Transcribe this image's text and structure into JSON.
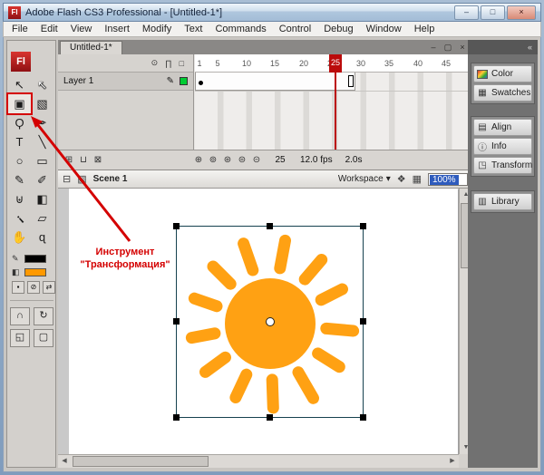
{
  "window": {
    "title": "Adobe Flash CS3 Professional - [Untitled-1*]",
    "logo": "Fl",
    "controls": {
      "minimize": "–",
      "maximize": "□",
      "close": "×"
    }
  },
  "menu": {
    "items": [
      "File",
      "Edit",
      "View",
      "Insert",
      "Modify",
      "Text",
      "Commands",
      "Control",
      "Debug",
      "Window",
      "Help"
    ]
  },
  "document_tab": {
    "label": "Untitled-1*",
    "controls": {
      "minimize": "–",
      "restore": "▢",
      "close": "×"
    }
  },
  "toolbar": {
    "logo": "Fl",
    "tools": [
      {
        "name": "selection",
        "glyph": "↖"
      },
      {
        "name": "subselection",
        "glyph": "↖"
      },
      {
        "name": "free-transform",
        "glyph": "▣"
      },
      {
        "name": "gradient-transform",
        "glyph": "▧"
      },
      {
        "name": "lasso",
        "glyph": "Ϙ"
      },
      {
        "name": "pen",
        "glyph": "✒"
      },
      {
        "name": "text",
        "glyph": "T"
      },
      {
        "name": "line",
        "glyph": "╲"
      },
      {
        "name": "oval",
        "glyph": "○"
      },
      {
        "name": "rectangle",
        "glyph": "▭"
      },
      {
        "name": "pencil",
        "glyph": "✎"
      },
      {
        "name": "brush",
        "glyph": "✐"
      },
      {
        "name": "ink-bottle",
        "glyph": "⊎"
      },
      {
        "name": "paint-bucket",
        "glyph": "◧"
      },
      {
        "name": "eyedropper",
        "glyph": "¡"
      },
      {
        "name": "eraser",
        "glyph": "▱"
      },
      {
        "name": "hand",
        "glyph": "✋"
      },
      {
        "name": "zoom",
        "glyph": "ɋ"
      }
    ],
    "colors": {
      "stroke": "#000000",
      "fill": "#ff9900"
    },
    "color_buttons": [
      {
        "name": "black-and-white",
        "glyph": "▪"
      },
      {
        "name": "no-color",
        "glyph": "⊘"
      },
      {
        "name": "swap-colors",
        "glyph": "⇄"
      }
    ],
    "options": [
      {
        "name": "snap-to-objects",
        "glyph": "∩"
      },
      {
        "name": "rotate-and-skew",
        "glyph": "↻"
      },
      {
        "name": "scale",
        "glyph": "◱"
      },
      {
        "name": "envelope",
        "glyph": "▢"
      }
    ]
  },
  "timeline": {
    "header_icons": [
      {
        "name": "show-hide-all-layers",
        "glyph": "⊙"
      },
      {
        "name": "lock-all-layers",
        "glyph": "∏"
      },
      {
        "name": "outline-all-layers",
        "glyph": "□"
      }
    ],
    "layer": {
      "name": "Layer 1",
      "edit_glyph": "✎"
    },
    "layer_outline_color": "#00cc33",
    "ruler": [
      "1",
      "5",
      "10",
      "15",
      "20",
      "25",
      "30",
      "35",
      "40",
      "45"
    ],
    "playhead_frame": "25",
    "status": {
      "current_frame": "25",
      "frame_rate": "12.0 fps",
      "elapsed_time": "2.0s"
    },
    "layer_buttons": [
      {
        "name": "insert-layer",
        "glyph": "⊞"
      },
      {
        "name": "insert-folder",
        "glyph": "⊔"
      },
      {
        "name": "delete-layer",
        "glyph": "⊠"
      }
    ],
    "onion_buttons": [
      {
        "name": "center-frame",
        "glyph": "⊕"
      },
      {
        "name": "onion-skin",
        "glyph": "⊚"
      },
      {
        "name": "onion-skin-outlines",
        "glyph": "⊛"
      },
      {
        "name": "edit-multiple-frames",
        "glyph": "⊜"
      },
      {
        "name": "modify-onion-markers",
        "glyph": "⊝"
      }
    ]
  },
  "edit_bar": {
    "back_icon": "⊟",
    "scene_icon": "▧",
    "scene": "Scene 1",
    "workspace_label": "Workspace",
    "workspace_caret": "▾",
    "edit_symbols_icon": "❖",
    "edit_scene_icon": "▦",
    "zoom_value": "100%"
  },
  "stage": {
    "sun_color": "#ffa113",
    "selection_border_color": "#16414f"
  },
  "dock": {
    "collapse_glyph": "«",
    "panels": [
      {
        "label": "Color"
      },
      {
        "label": "Swatches",
        "glyph": "▦"
      },
      {
        "label": "Align",
        "glyph": "▤"
      },
      {
        "label": "Info",
        "glyph": "ⓘ"
      },
      {
        "label": "Transform",
        "glyph": "◳"
      },
      {
        "label": "Library",
        "glyph": "▥"
      }
    ]
  },
  "annotation": {
    "line1": "Инструмент",
    "line2": "\"Трансформация\"",
    "color": "#d40000"
  }
}
